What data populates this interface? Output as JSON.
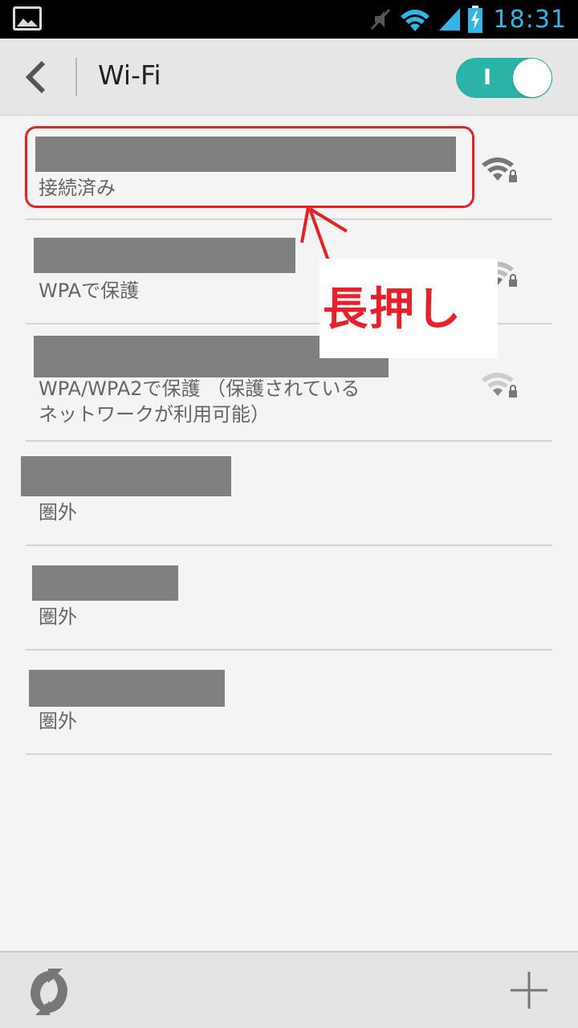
{
  "status_bar": {
    "time": "18:31",
    "icons": [
      "gallery-icon",
      "mute-icon",
      "wifi-icon",
      "cell-signal-icon",
      "battery-charging-icon"
    ],
    "accent_color": "#33b5e5"
  },
  "action_bar": {
    "title": "Wi-Fi",
    "toggle_label": "I",
    "toggle_color": "#2bb3a8"
  },
  "networks": [
    {
      "status": "接続済み",
      "signal": "full-locked"
    },
    {
      "status": "WPAで保護",
      "signal": "full-locked"
    },
    {
      "status": "WPA/WPA2で保護 （保護されている\nネットワークが利用可能）",
      "signal": "full-locked"
    },
    {
      "status": "圏外",
      "signal": "none"
    },
    {
      "status": "圏外",
      "signal": "none"
    },
    {
      "status": "圏外",
      "signal": "none"
    }
  ],
  "annotation": {
    "text": "長押し",
    "color": "#e8202a"
  },
  "bottom_bar": {
    "icons": [
      "refresh-icon",
      "add-icon"
    ]
  }
}
